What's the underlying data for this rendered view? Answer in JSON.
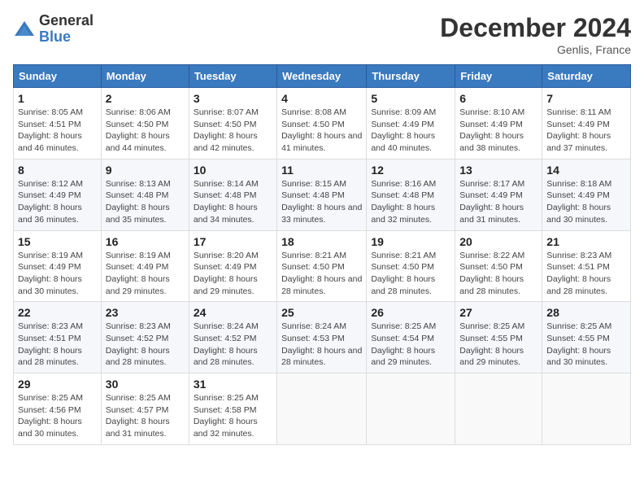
{
  "logo": {
    "general": "General",
    "blue": "Blue"
  },
  "header": {
    "month_year": "December 2024",
    "location": "Genlis, France"
  },
  "weekdays": [
    "Sunday",
    "Monday",
    "Tuesday",
    "Wednesday",
    "Thursday",
    "Friday",
    "Saturday"
  ],
  "weeks": [
    [
      {
        "day": "1",
        "sunrise": "8:05 AM",
        "sunset": "4:51 PM",
        "daylight": "8 hours and 46 minutes."
      },
      {
        "day": "2",
        "sunrise": "8:06 AM",
        "sunset": "4:50 PM",
        "daylight": "8 hours and 44 minutes."
      },
      {
        "day": "3",
        "sunrise": "8:07 AM",
        "sunset": "4:50 PM",
        "daylight": "8 hours and 42 minutes."
      },
      {
        "day": "4",
        "sunrise": "8:08 AM",
        "sunset": "4:50 PM",
        "daylight": "8 hours and 41 minutes."
      },
      {
        "day": "5",
        "sunrise": "8:09 AM",
        "sunset": "4:49 PM",
        "daylight": "8 hours and 40 minutes."
      },
      {
        "day": "6",
        "sunrise": "8:10 AM",
        "sunset": "4:49 PM",
        "daylight": "8 hours and 38 minutes."
      },
      {
        "day": "7",
        "sunrise": "8:11 AM",
        "sunset": "4:49 PM",
        "daylight": "8 hours and 37 minutes."
      }
    ],
    [
      {
        "day": "8",
        "sunrise": "8:12 AM",
        "sunset": "4:49 PM",
        "daylight": "8 hours and 36 minutes."
      },
      {
        "day": "9",
        "sunrise": "8:13 AM",
        "sunset": "4:48 PM",
        "daylight": "8 hours and 35 minutes."
      },
      {
        "day": "10",
        "sunrise": "8:14 AM",
        "sunset": "4:48 PM",
        "daylight": "8 hours and 34 minutes."
      },
      {
        "day": "11",
        "sunrise": "8:15 AM",
        "sunset": "4:48 PM",
        "daylight": "8 hours and 33 minutes."
      },
      {
        "day": "12",
        "sunrise": "8:16 AM",
        "sunset": "4:48 PM",
        "daylight": "8 hours and 32 minutes."
      },
      {
        "day": "13",
        "sunrise": "8:17 AM",
        "sunset": "4:49 PM",
        "daylight": "8 hours and 31 minutes."
      },
      {
        "day": "14",
        "sunrise": "8:18 AM",
        "sunset": "4:49 PM",
        "daylight": "8 hours and 30 minutes."
      }
    ],
    [
      {
        "day": "15",
        "sunrise": "8:19 AM",
        "sunset": "4:49 PM",
        "daylight": "8 hours and 30 minutes."
      },
      {
        "day": "16",
        "sunrise": "8:19 AM",
        "sunset": "4:49 PM",
        "daylight": "8 hours and 29 minutes."
      },
      {
        "day": "17",
        "sunrise": "8:20 AM",
        "sunset": "4:49 PM",
        "daylight": "8 hours and 29 minutes."
      },
      {
        "day": "18",
        "sunrise": "8:21 AM",
        "sunset": "4:50 PM",
        "daylight": "8 hours and 28 minutes."
      },
      {
        "day": "19",
        "sunrise": "8:21 AM",
        "sunset": "4:50 PM",
        "daylight": "8 hours and 28 minutes."
      },
      {
        "day": "20",
        "sunrise": "8:22 AM",
        "sunset": "4:50 PM",
        "daylight": "8 hours and 28 minutes."
      },
      {
        "day": "21",
        "sunrise": "8:23 AM",
        "sunset": "4:51 PM",
        "daylight": "8 hours and 28 minutes."
      }
    ],
    [
      {
        "day": "22",
        "sunrise": "8:23 AM",
        "sunset": "4:51 PM",
        "daylight": "8 hours and 28 minutes."
      },
      {
        "day": "23",
        "sunrise": "8:23 AM",
        "sunset": "4:52 PM",
        "daylight": "8 hours and 28 minutes."
      },
      {
        "day": "24",
        "sunrise": "8:24 AM",
        "sunset": "4:52 PM",
        "daylight": "8 hours and 28 minutes."
      },
      {
        "day": "25",
        "sunrise": "8:24 AM",
        "sunset": "4:53 PM",
        "daylight": "8 hours and 28 minutes."
      },
      {
        "day": "26",
        "sunrise": "8:25 AM",
        "sunset": "4:54 PM",
        "daylight": "8 hours and 29 minutes."
      },
      {
        "day": "27",
        "sunrise": "8:25 AM",
        "sunset": "4:55 PM",
        "daylight": "8 hours and 29 minutes."
      },
      {
        "day": "28",
        "sunrise": "8:25 AM",
        "sunset": "4:55 PM",
        "daylight": "8 hours and 30 minutes."
      }
    ],
    [
      {
        "day": "29",
        "sunrise": "8:25 AM",
        "sunset": "4:56 PM",
        "daylight": "8 hours and 30 minutes."
      },
      {
        "day": "30",
        "sunrise": "8:25 AM",
        "sunset": "4:57 PM",
        "daylight": "8 hours and 31 minutes."
      },
      {
        "day": "31",
        "sunrise": "8:25 AM",
        "sunset": "4:58 PM",
        "daylight": "8 hours and 32 minutes."
      },
      null,
      null,
      null,
      null
    ]
  ],
  "labels": {
    "sunrise": "Sunrise:",
    "sunset": "Sunset:",
    "daylight": "Daylight:"
  }
}
